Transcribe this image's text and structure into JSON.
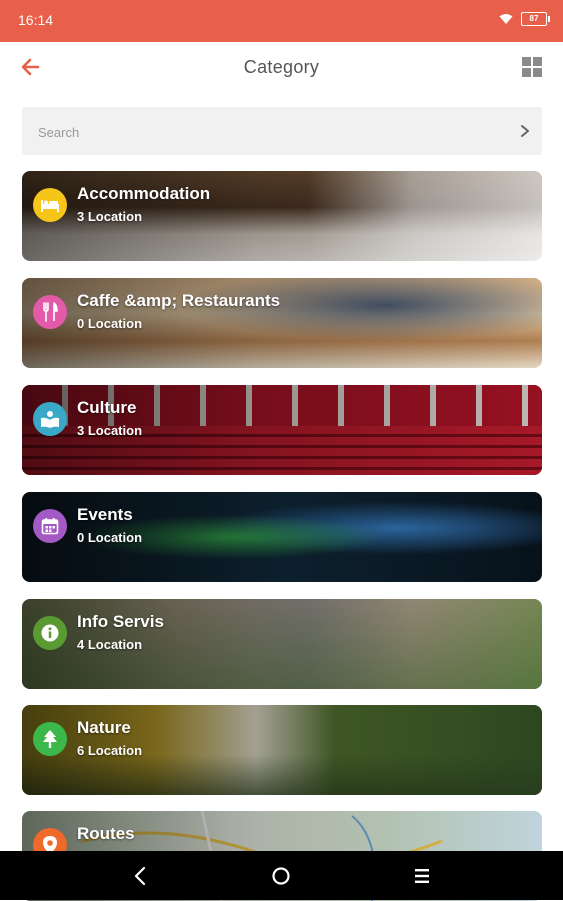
{
  "status": {
    "time": "16:14",
    "battery": "87"
  },
  "header": {
    "title": "Category",
    "back_icon": "arrow-left-icon",
    "view_toggle_icon": "grid-view-icon",
    "accent_color": "#e8604c"
  },
  "search": {
    "placeholder": "Search",
    "value": ""
  },
  "categories": [
    {
      "title": "Accommodation",
      "count": "3 Location",
      "icon": "bed-icon",
      "icon_color": "#f5c518"
    },
    {
      "title": "Caffe &amp; Restaurants",
      "count": "0 Location",
      "icon": "fork-knife-icon",
      "icon_color": "#e35aa8"
    },
    {
      "title": "Culture",
      "count": "3 Location",
      "icon": "book-reader-icon",
      "icon_color": "#3aa9c7"
    },
    {
      "title": "Events",
      "count": "0 Location",
      "icon": "calendar-icon",
      "icon_color": "#a45ac4"
    },
    {
      "title": "Info Servis",
      "count": "4 Location",
      "icon": "info-icon",
      "icon_color": "#5a9a32"
    },
    {
      "title": "Nature",
      "count": "6 Location",
      "icon": "tree-icon",
      "icon_color": "#3cb84a"
    },
    {
      "title": "Routes",
      "count": "",
      "icon": "map-pin-icon",
      "icon_color": "#ef6a2a"
    }
  ],
  "nav": {
    "back": "nav-back-icon",
    "home": "nav-home-icon",
    "recents": "nav-recents-icon"
  }
}
